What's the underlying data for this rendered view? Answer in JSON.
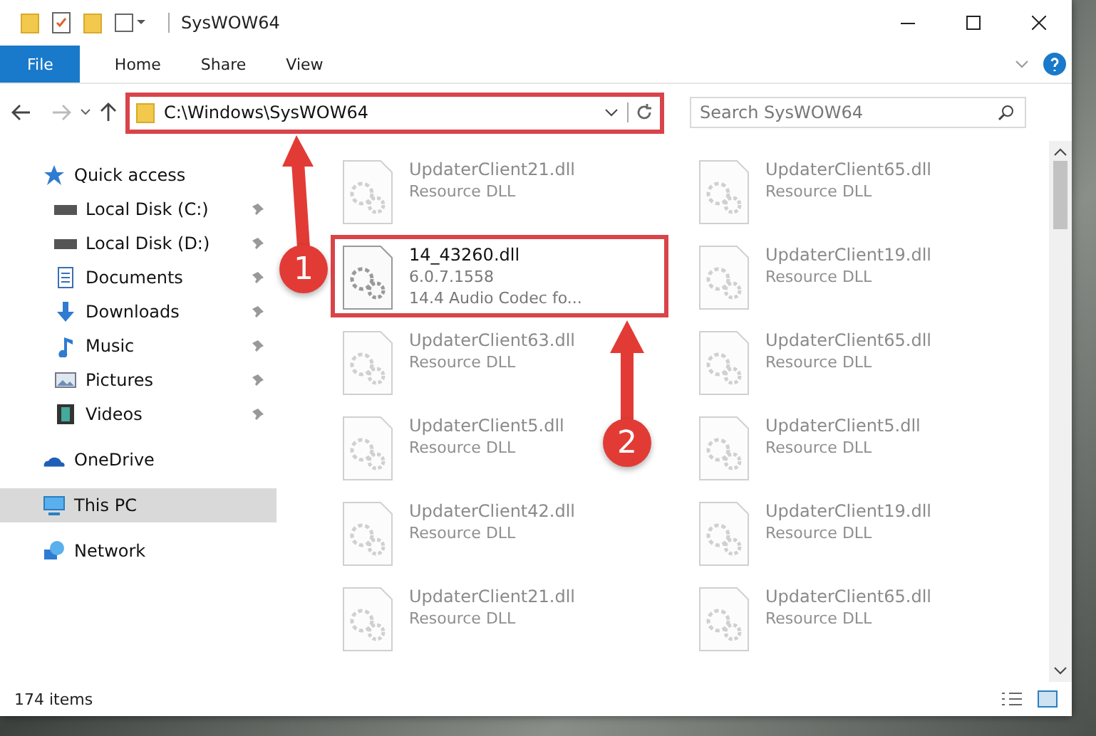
{
  "window": {
    "title": "SysWOW64"
  },
  "ribbon_tabs": [
    {
      "label": "File",
      "kind": "file"
    },
    {
      "label": "Home",
      "kind": "tab"
    },
    {
      "label": "Share",
      "kind": "tab"
    },
    {
      "label": "View",
      "kind": "tab"
    }
  ],
  "address_bar": {
    "path": "C:\\Windows\\SysWOW64",
    "highlighted": true
  },
  "search": {
    "placeholder": "Search SysWOW64"
  },
  "sidebar": {
    "items": [
      {
        "label": "Quick access",
        "kind": "star",
        "selected": false,
        "children": [
          {
            "label": "Local Disk (C:)",
            "kind": "drive",
            "pinned": true
          },
          {
            "label": "Local Disk (D:)",
            "kind": "drive",
            "pinned": true
          },
          {
            "label": "Documents",
            "kind": "documents",
            "pinned": true
          },
          {
            "label": "Downloads",
            "kind": "downloads",
            "pinned": true
          },
          {
            "label": "Music",
            "kind": "music",
            "pinned": true
          },
          {
            "label": "Pictures",
            "kind": "pictures",
            "pinned": true
          },
          {
            "label": "Videos",
            "kind": "videos",
            "pinned": true
          }
        ]
      },
      {
        "label": "OneDrive",
        "kind": "cloud",
        "selected": false
      },
      {
        "label": "This PC",
        "kind": "pc",
        "selected": true
      },
      {
        "label": "Network",
        "kind": "network",
        "selected": false
      }
    ]
  },
  "files": [
    {
      "name": "UpdaterClient21.dll",
      "details": [
        "Resource DLL"
      ],
      "dimmed": true,
      "highlighted": false
    },
    {
      "name": "UpdaterClient65.dll",
      "details": [
        "Resource DLL"
      ],
      "dimmed": true,
      "highlighted": false
    },
    {
      "name": "14_43260.dll",
      "details": [
        "6.0.7.1558",
        "14.4 Audio Codec fo..."
      ],
      "dimmed": false,
      "highlighted": true
    },
    {
      "name": "UpdaterClient19.dll",
      "details": [
        "Resource DLL"
      ],
      "dimmed": true,
      "highlighted": false
    },
    {
      "name": "UpdaterClient63.dll",
      "details": [
        "Resource DLL"
      ],
      "dimmed": true,
      "highlighted": false
    },
    {
      "name": "UpdaterClient65.dll",
      "details": [
        "Resource DLL"
      ],
      "dimmed": true,
      "highlighted": false
    },
    {
      "name": "UpdaterClient5.dll",
      "details": [
        "Resource DLL"
      ],
      "dimmed": true,
      "highlighted": false
    },
    {
      "name": "UpdaterClient5.dll",
      "details": [
        "Resource DLL"
      ],
      "dimmed": true,
      "highlighted": false
    },
    {
      "name": "UpdaterClient42.dll",
      "details": [
        "Resource DLL"
      ],
      "dimmed": true,
      "highlighted": false
    },
    {
      "name": "UpdaterClient19.dll",
      "details": [
        "Resource DLL"
      ],
      "dimmed": true,
      "highlighted": false
    },
    {
      "name": "UpdaterClient21.dll",
      "details": [
        "Resource DLL"
      ],
      "dimmed": true,
      "highlighted": false
    },
    {
      "name": "UpdaterClient65.dll",
      "details": [
        "Resource DLL"
      ],
      "dimmed": true,
      "highlighted": false
    }
  ],
  "status_bar": {
    "item_count": "174 items"
  },
  "annotations": [
    {
      "label": "1"
    },
    {
      "label": "2"
    }
  ]
}
